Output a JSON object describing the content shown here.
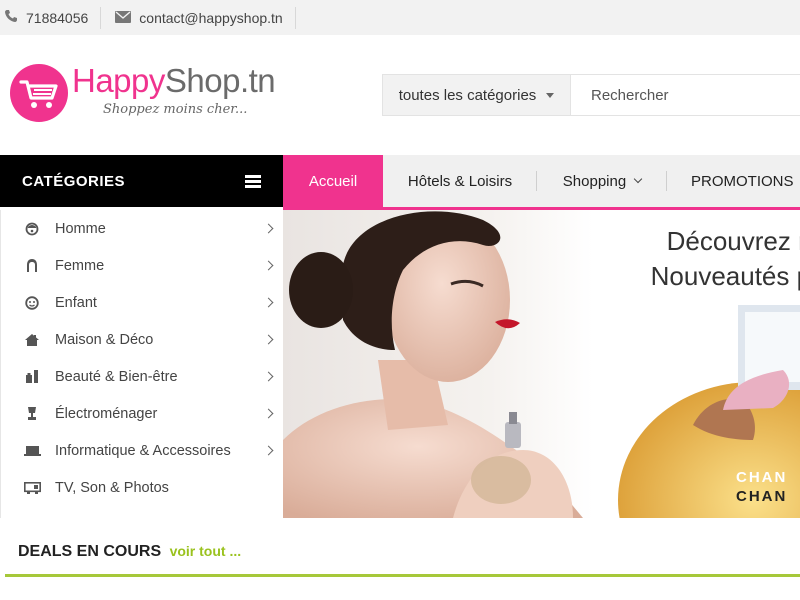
{
  "colors": {
    "brand_pink": "#f0338e",
    "deals_green": "#a6c83a",
    "nav_black": "#000000"
  },
  "topbar": {
    "phone": {
      "icon": "phone-icon",
      "text": "71884056"
    },
    "email": {
      "icon": "envelope-icon",
      "text": "contact@happyshop.tn"
    }
  },
  "logo": {
    "icon": "shopping-cart-icon",
    "word_part1": "Happy",
    "word_part2": "Shop.tn",
    "tagline": "Shoppez moins cher..."
  },
  "search": {
    "category_label": "toutes les catégories",
    "placeholder": "Rechercher"
  },
  "nav": {
    "categories_title": "CATÉGORIES",
    "tabs": [
      {
        "label": "Accueil",
        "active": true
      },
      {
        "label": "Hôtels & Loisirs"
      },
      {
        "label": "Shopping",
        "has_dropdown": true
      },
      {
        "label": "PROMOTIONS"
      }
    ]
  },
  "sidebar": {
    "items": [
      {
        "label": "Homme",
        "icon": "man-icon",
        "has_submenu": true
      },
      {
        "label": "Femme",
        "icon": "woman-icon",
        "has_submenu": true
      },
      {
        "label": "Enfant",
        "icon": "child-icon",
        "has_submenu": true
      },
      {
        "label": "Maison & Déco",
        "icon": "house-icon",
        "has_submenu": true
      },
      {
        "label": "Beauté & Bien-être",
        "icon": "perfume-icon",
        "has_submenu": true
      },
      {
        "label": "Électroménager",
        "icon": "appliance-icon",
        "has_submenu": true
      },
      {
        "label": "Informatique & Accessoires",
        "icon": "laptop-icon",
        "has_submenu": true
      },
      {
        "label": "TV, Son & Photos",
        "icon": "tv-icon",
        "has_submenu": false
      }
    ]
  },
  "banner": {
    "line1": "Découvrez nos",
    "line2": "Nouveautés pou",
    "brand_line1": "CHAN",
    "brand_line2": "CHAN"
  },
  "deals": {
    "title": "DEALS EN COURS",
    "link": "voir tout ..."
  }
}
